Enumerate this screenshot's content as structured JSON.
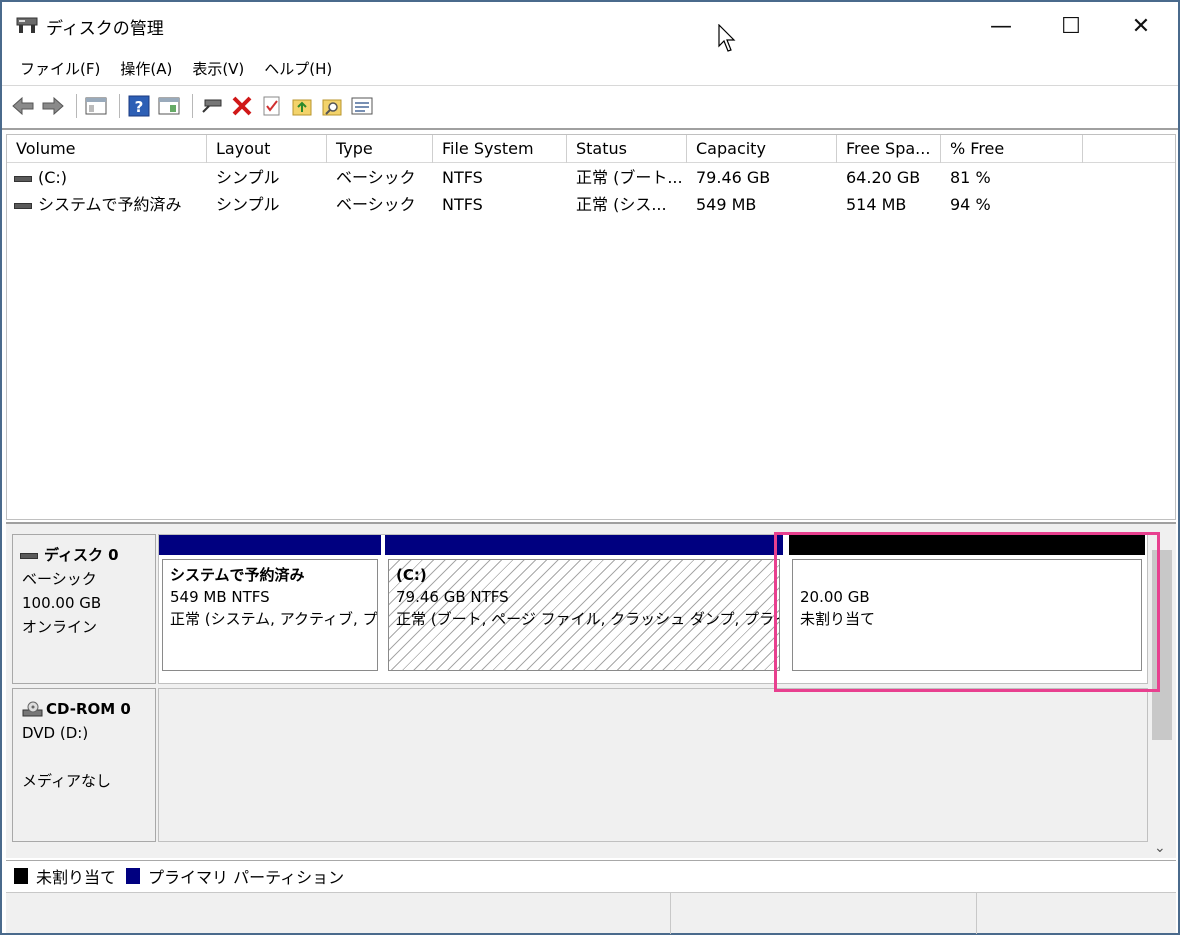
{
  "window": {
    "title": "ディスクの管理",
    "minimize": "—",
    "maximize": "☐",
    "close": "✕"
  },
  "menu": [
    "ファイル(F)",
    "操作(A)",
    "表示(V)",
    "ヘルプ(H)"
  ],
  "toolbar": [
    "back-icon",
    "forward-icon",
    "console-tree-icon",
    "help-icon",
    "action-pane-icon",
    "map-drive-icon",
    "delete-icon",
    "properties-icon",
    "folder-up-icon",
    "search-icon",
    "list-icon"
  ],
  "volume_list": {
    "columns": [
      "Volume",
      "Layout",
      "Type",
      "File System",
      "Status",
      "Capacity",
      "Free Spa...",
      "% Free"
    ],
    "rows": [
      [
        "(C:)",
        "シンプル",
        "ベーシック",
        "NTFS",
        "正常 (ブート...",
        "79.46 GB",
        "64.20 GB",
        "81 %"
      ],
      [
        "システムで予約済み",
        "シンプル",
        "ベーシック",
        "NTFS",
        "正常 (シス...",
        "549 MB",
        "514 MB",
        "94 %"
      ]
    ]
  },
  "disks": {
    "disk0": {
      "name": "ディスク 0",
      "type": "ベーシック",
      "size": "100.00 GB",
      "state": "オンライン",
      "partitions": [
        {
          "title": "システムで予約済み",
          "size": "549 MB NTFS",
          "status": "正常 (システム, アクティブ, プ"
        },
        {
          "title": "(C:)",
          "size": "79.46 GB NTFS",
          "status": "正常 (ブート, ページ ファイル, クラッシュ ダンプ, プライマ"
        },
        {
          "title": "",
          "size": "20.00 GB",
          "status": "未割り当て"
        }
      ]
    },
    "cdrom0": {
      "name": "CD-ROM 0",
      "drive": "DVD (D:)",
      "media": "メディアなし"
    }
  },
  "legend": {
    "unallocated": "未割り当て",
    "primary": "プライマリ パーティション"
  },
  "colors": {
    "primary_partition": "#000080",
    "unallocated": "#000000",
    "highlight": "#e8408f"
  }
}
